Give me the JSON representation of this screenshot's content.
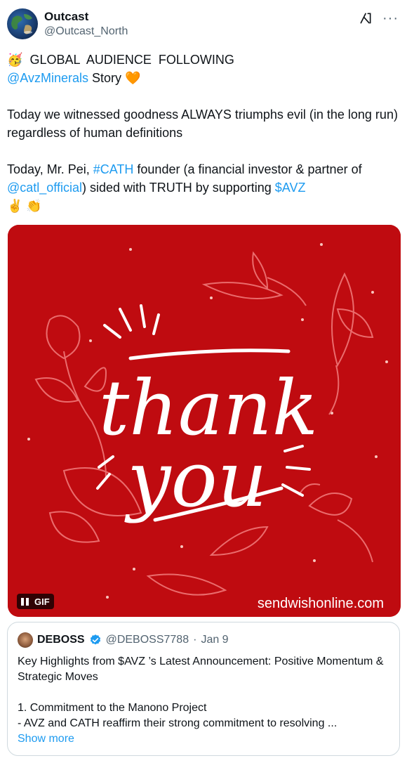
{
  "author": {
    "display_name": "Outcast",
    "handle": "@Outcast_North"
  },
  "actions": {
    "grok_icon": "grok-icon",
    "more_icon": "more-icon",
    "more_glyph": "···"
  },
  "tweet": {
    "line1_emoji": "🥳",
    "line1_text": "GLOBAL  AUDIENCE  FOLLOWING",
    "line2_mention": "@AvzMinerals",
    "line2_text": " Story",
    "line2_emoji": "🧡",
    "para1": "Today we witnessed goodness ALWAYS triumphs evil (in the long run) regardless of human definitions",
    "para2_a": "Today, Mr. Pei, ",
    "para2_hashtag": "#CATH",
    "para2_b": " founder (a financial investor & partner of ",
    "para2_mention": "@catl_official",
    "para2_c": ") sided with TRUTH by supporting ",
    "para2_cashtag": "$AVZ",
    "emoji_end": "✌️ 👏"
  },
  "media": {
    "headline1": "thank",
    "headline2": "you",
    "watermark": "sendwishonline.com",
    "gif_label": "GIF",
    "background_color": "#bf0b10"
  },
  "quote": {
    "display_name": "DEBOSS",
    "handle": "@DEBOSS7788",
    "separator": "·",
    "date": "Jan 9",
    "title": "Key Highlights from $AVZ ’s Latest Announcement: Positive Momentum & Strategic Moves",
    "point1": "1. Commitment to the Manono Project",
    "point2": "- AVZ and CATH reaffirm their strong commitment to resolving ...",
    "show_more": "Show more"
  }
}
